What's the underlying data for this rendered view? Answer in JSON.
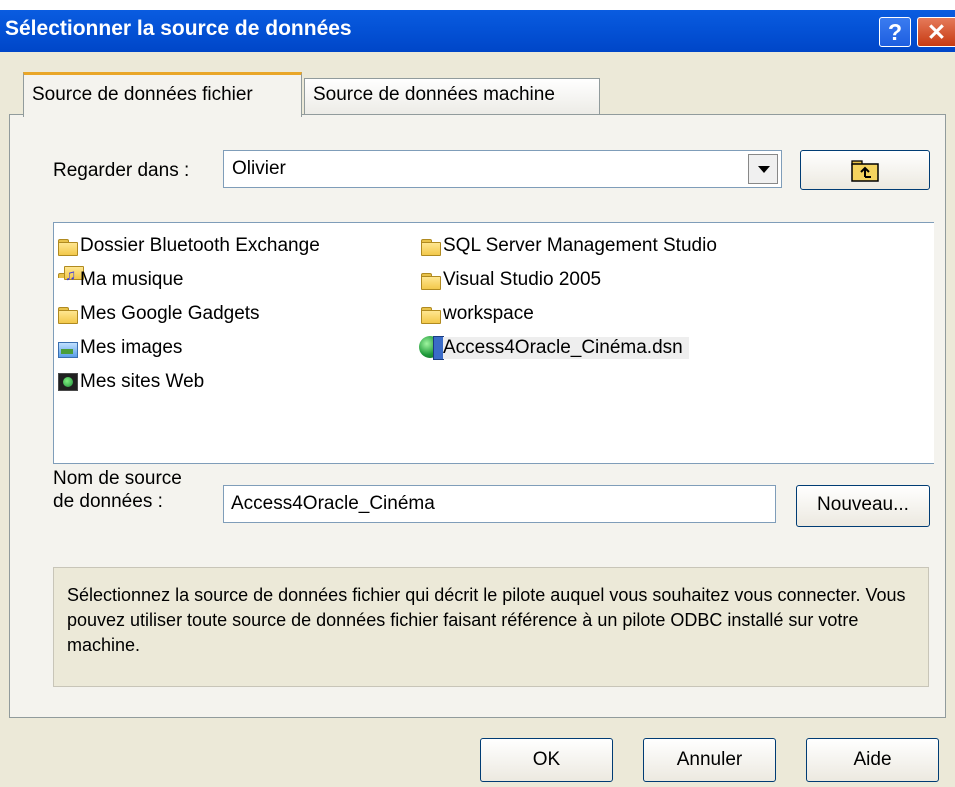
{
  "window": {
    "title": "Sélectionner la source de données",
    "help_label": "?",
    "close_label": "✕"
  },
  "tabs": [
    {
      "label": "Source de données fichier",
      "active": true
    },
    {
      "label": "Source de données machine",
      "active": false
    }
  ],
  "look_in": {
    "label": "Regarder dans :",
    "value": "Olivier"
  },
  "files": [
    {
      "name": "Dossier Bluetooth Exchange",
      "icon": "folder-icon"
    },
    {
      "name": "Ma musique",
      "icon": "music-folder-icon"
    },
    {
      "name": "Mes Google Gadgets",
      "icon": "folder-icon"
    },
    {
      "name": "Mes images",
      "icon": "pictures-folder-icon"
    },
    {
      "name": "Mes sites Web",
      "icon": "web-sites-icon"
    },
    {
      "name": "SQL Server Management Studio",
      "icon": "folder-icon"
    },
    {
      "name": "Visual Studio 2005",
      "icon": "folder-icon"
    },
    {
      "name": "workspace",
      "icon": "folder-icon"
    },
    {
      "name": "Access4Oracle_Cinéma.dsn",
      "icon": "dsn-file-icon",
      "selected": true
    }
  ],
  "dsn_name": {
    "label_line1": "Nom de source",
    "label_line2": "de données :",
    "value": "Access4Oracle_Cinéma"
  },
  "new_button": "Nouveau...",
  "description": "Sélectionnez la source de données fichier qui décrit le pilote auquel vous souhaitez vous connecter. Vous pouvez utiliser toute source de données fichier faisant référence à un pilote ODBC installé sur votre machine.",
  "buttons": {
    "ok": "OK",
    "cancel": "Annuler",
    "help": "Aide"
  },
  "colors": {
    "titlebar": "#0054e3",
    "dialog_bg": "#ece9d8",
    "active_tab_accent": "#e9a628"
  }
}
